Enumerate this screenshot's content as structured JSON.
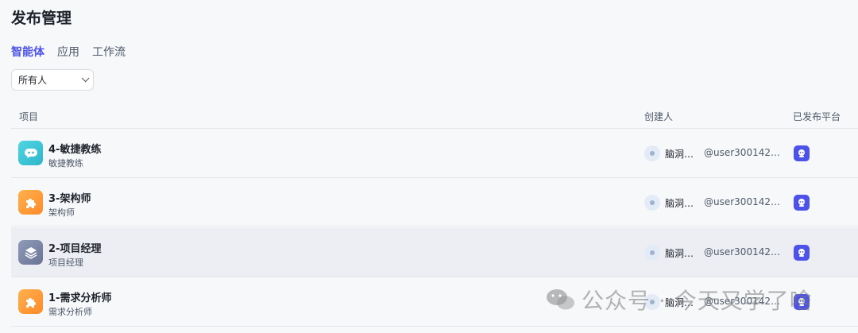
{
  "page": {
    "title": "发布管理"
  },
  "tabs": [
    {
      "label": "智能体",
      "active": true
    },
    {
      "label": "应用",
      "active": false
    },
    {
      "label": "工作流",
      "active": false
    }
  ],
  "filter": {
    "value": "所有人"
  },
  "table": {
    "headers": {
      "project": "项目",
      "creator": "创建人",
      "platform": "已发布平台"
    },
    "rows": [
      {
        "title": "4-敏捷教练",
        "subtitle": "敏捷教练",
        "icon": "chat-bubble-icon",
        "icon_color": "#3cc6d8",
        "creator": "脑洞…",
        "handle": "@user300142…"
      },
      {
        "title": "3-架构师",
        "subtitle": "架构师",
        "icon": "puzzle-icon",
        "icon_color": "#ff9a3c",
        "creator": "脑洞…",
        "handle": "@user300142…"
      },
      {
        "title": "2-项目经理",
        "subtitle": "项目经理",
        "icon": "layers-icon",
        "icon_color": "#7a86a8",
        "creator": "脑洞…",
        "handle": "@user300142…"
      },
      {
        "title": "1-需求分析师",
        "subtitle": "需求分析师",
        "icon": "puzzle-icon",
        "icon_color": "#ff9a3c",
        "creator": "脑洞…",
        "handle": "@user300142…"
      }
    ]
  },
  "watermark": {
    "text": "公众号 · 今天又学了啥"
  }
}
